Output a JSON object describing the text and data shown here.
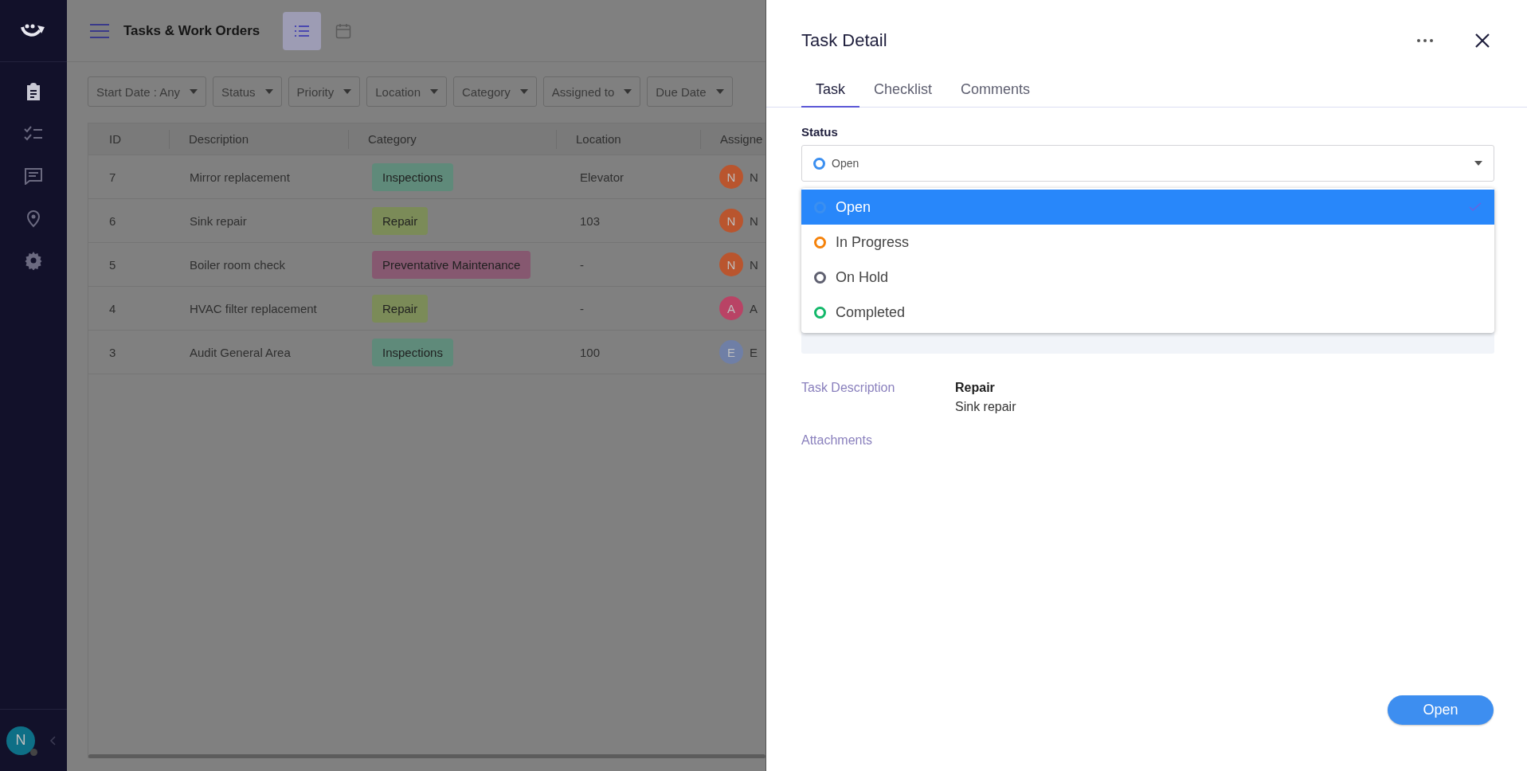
{
  "sidebar": {
    "items": [
      {
        "selected": true
      },
      {
        "selected": false
      },
      {
        "selected": false
      },
      {
        "selected": false
      },
      {
        "selected": false
      }
    ],
    "user": {
      "initial": "N",
      "color": "#0e6f86"
    }
  },
  "header": {
    "title": "Tasks & Work Orders",
    "views": [
      {
        "selected": true
      },
      {
        "selected": false
      }
    ]
  },
  "filters": [
    "Start Date : Any",
    "Status",
    "Priority",
    "Location",
    "Category",
    "Assigned to",
    "Due Date"
  ],
  "table": {
    "columns": [
      "ID",
      "Description",
      "Category",
      "Location",
      "Assigne"
    ],
    "rows": [
      {
        "id": "7",
        "description": "Mirror replacement",
        "category": {
          "label": "Inspections",
          "color": "#5f8a7a"
        },
        "location": "Elevator",
        "assignee": {
          "initial": "N",
          "color": "#b9552e",
          "name": "N"
        }
      },
      {
        "id": "6",
        "description": "Sink repair",
        "category": {
          "label": "Repair",
          "color": "#7b8b58"
        },
        "location": "103",
        "assignee": {
          "initial": "N",
          "color": "#b9552e",
          "name": "N"
        }
      },
      {
        "id": "5",
        "description": "Boiler room check",
        "category": {
          "label": "Preventative Maintenance",
          "color": "#865870"
        },
        "location": "-",
        "assignee": {
          "initial": "N",
          "color": "#b9552e",
          "name": "N"
        }
      },
      {
        "id": "4",
        "description": "HVAC filter replacement",
        "category": {
          "label": "Repair",
          "color": "#7b8b58"
        },
        "location": "-",
        "assignee": {
          "initial": "A",
          "color": "#b94365",
          "name": "A"
        }
      },
      {
        "id": "3",
        "description": "Audit General Area",
        "category": {
          "label": "Inspections",
          "color": "#5f8a7a"
        },
        "location": "100",
        "assignee": {
          "initial": "E",
          "color": "#6f7fa6",
          "name": "E"
        }
      }
    ]
  },
  "panel": {
    "title": "Task Detail",
    "tabs": [
      {
        "label": "Task",
        "selected": true
      },
      {
        "label": "Checklist",
        "selected": false
      },
      {
        "label": "Comments",
        "selected": false
      }
    ],
    "status": {
      "label": "Status",
      "value": "Open",
      "color": "#3b8ff0",
      "options": [
        {
          "label": "Open",
          "color": "#3b8ff0",
          "selected": true
        },
        {
          "label": "In Progress",
          "color": "#f5820a",
          "selected": false
        },
        {
          "label": "On Hold",
          "color": "#5f6070",
          "selected": false
        },
        {
          "label": "Completed",
          "color": "#12b86a",
          "selected": false
        }
      ]
    },
    "description": {
      "label": "Task Description",
      "title": "Repair",
      "text": "Sink repair"
    },
    "attachments": {
      "label": "Attachments"
    },
    "button": "Open"
  }
}
